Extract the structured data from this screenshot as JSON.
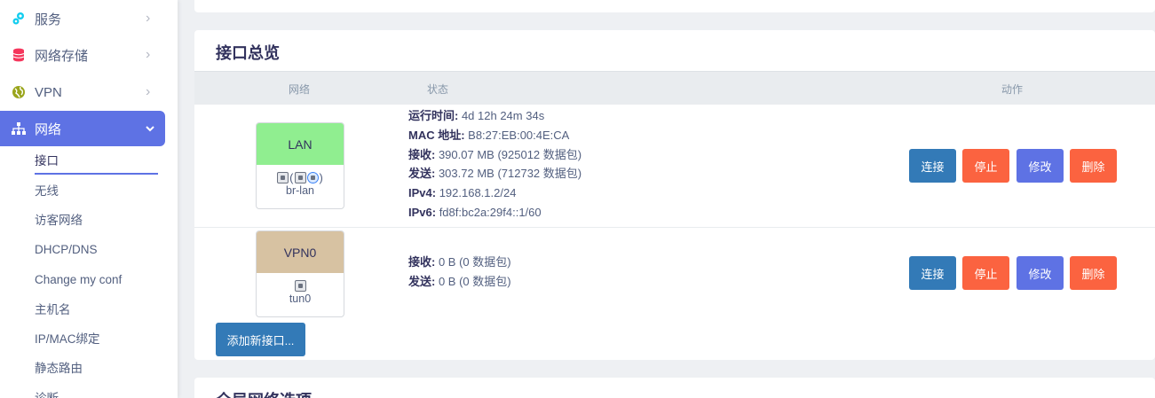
{
  "sidebar": {
    "items": [
      {
        "label": "服务",
        "icon": "gears-icon"
      },
      {
        "label": "网络存储",
        "icon": "database-icon"
      },
      {
        "label": "VPN",
        "icon": "globe-icon"
      },
      {
        "label": "网络",
        "icon": "sitemap-icon"
      }
    ],
    "sub_items": [
      "接口",
      "无线",
      "访客网络",
      "DHCP/DNS",
      "Change my conf",
      "主机名",
      "IP/MAC绑定",
      "静态路由",
      "诊断"
    ]
  },
  "main": {
    "title": "接口总览",
    "columns": {
      "network": "网络",
      "status": "状态",
      "actions": "动作"
    },
    "interfaces": [
      {
        "name": "LAN",
        "device": "br-lan",
        "color": "#90ee90",
        "status": [
          {
            "label": "运行时间:",
            "value": " 4d 12h 24m 34s"
          },
          {
            "label": "MAC 地址:",
            "value": " B8:27:EB:00:4E:CA"
          },
          {
            "label": "接收:",
            "value": " 390.07 MB (925012 数据包)"
          },
          {
            "label": "发送:",
            "value": " 303.72 MB (712732 数据包)"
          },
          {
            "label": "IPv4:",
            "value": " 192.168.1.2/24"
          },
          {
            "label": "IPv6:",
            "value": " fd8f:bc2a:29f4::1/60"
          }
        ]
      },
      {
        "name": "VPN0",
        "device": "tun0",
        "color": "#d7c2a2",
        "status": [
          {
            "label": "接收:",
            "value": " 0 B (0 数据包)"
          },
          {
            "label": "发送:",
            "value": " 0 B (0 数据包)"
          }
        ]
      }
    ],
    "buttons": {
      "connect": "连接",
      "stop": "停止",
      "edit": "修改",
      "delete": "删除"
    },
    "add_button": "添加新接口...",
    "next_section_title": "全局网络选项"
  },
  "colors": {
    "accent": "#5e72e4",
    "connect": "#337ab7",
    "danger": "#fb6340"
  }
}
